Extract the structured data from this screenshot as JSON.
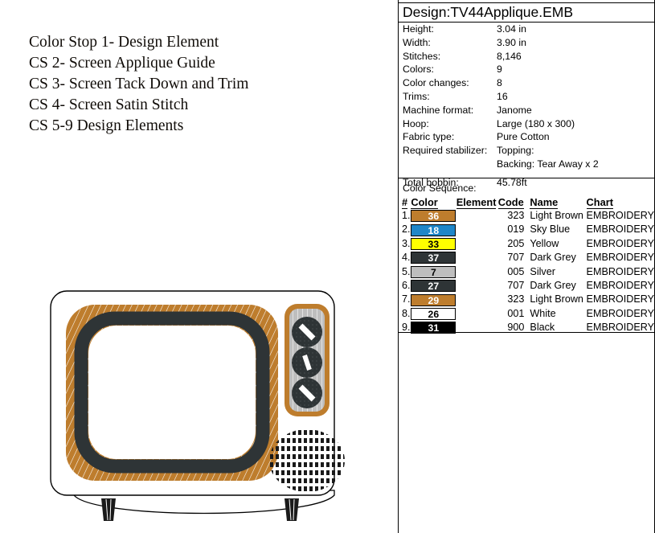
{
  "instructions": {
    "lines": [
      "Color Stop 1- Design Element",
      "CS 2- Screen Applique Guide",
      "CS 3- Screen Tack Down and Trim",
      "CS 4- Screen Satin Stitch",
      "CS 5-9 Design Elements"
    ]
  },
  "artwork": {
    "name": "vintage-television-embroidery-preview",
    "colors": {
      "cabinet_outline": "#000000",
      "bezel_brown": "#BE7D2D",
      "bezel_hatch": "#FFFFFF",
      "screen_border_dark": "#2E3436",
      "screen_fill": "#FFFFFF",
      "knob_panel_silver": "#BEBEBE",
      "knob_dark": "#2E3436",
      "knob_marker": "#FFFFFF",
      "speaker_dark": "#1A1A1A",
      "leg_dark": "#1A1A1A"
    },
    "knob_count": 3
  },
  "design": {
    "title": "Design:TV44Applique.EMB",
    "clipped_header": "",
    "info": [
      {
        "label": "Height:",
        "value": "3.04 in"
      },
      {
        "label": "Width:",
        "value": "3.90 in"
      },
      {
        "label": "Stitches:",
        "value": "8,146"
      },
      {
        "label": "Colors:",
        "value": "9"
      },
      {
        "label": "Color changes:",
        "value": "8"
      },
      {
        "label": "Trims:",
        "value": "16"
      },
      {
        "label": "Machine format:",
        "value": "Janome"
      },
      {
        "label": "Hoop:",
        "value": "Large (180 x 300)"
      },
      {
        "label": "Fabric type:",
        "value": "Pure Cotton"
      },
      {
        "label": "Required stabilizer:",
        "value": "Topping:"
      },
      {
        "label": "",
        "value": "Backing: Tear Away x 2"
      },
      {
        "label": "Total bobbin:",
        "value": "45.78ft"
      }
    ],
    "color_sequence_label": "Color Sequence:",
    "sequence_headers": [
      "#",
      "Color",
      "Element",
      "Code",
      "Name",
      "Chart"
    ],
    "sequence": [
      {
        "num": "1.",
        "swatch": "36",
        "swatch_color": "#BE7D2D",
        "swatch_text_color": "#FFFFFF",
        "element": "",
        "code": "323",
        "name": "Light Brown",
        "chart": "EMBROIDERY"
      },
      {
        "num": "2.",
        "swatch": "18",
        "swatch_color": "#1F86C8",
        "swatch_text_color": "#FFFFFF",
        "element": "",
        "code": "019",
        "name": "Sky Blue",
        "chart": "EMBROIDERY"
      },
      {
        "num": "3.",
        "swatch": "33",
        "swatch_color": "#FFFF00",
        "swatch_text_color": "#000000",
        "element": "",
        "code": "205",
        "name": "Yellow",
        "chart": "EMBROIDERY"
      },
      {
        "num": "4.",
        "swatch": "37",
        "swatch_color": "#2E3436",
        "swatch_text_color": "#FFFFFF",
        "element": "",
        "code": "707",
        "name": "Dark Grey",
        "chart": "EMBROIDERY"
      },
      {
        "num": "5.",
        "swatch": "7",
        "swatch_color": "#BEBEBE",
        "swatch_text_color": "#000000",
        "element": "",
        "code": "005",
        "name": "Silver",
        "chart": "EMBROIDERY"
      },
      {
        "num": "6.",
        "swatch": "27",
        "swatch_color": "#2E3436",
        "swatch_text_color": "#FFFFFF",
        "element": "",
        "code": "707",
        "name": "Dark Grey",
        "chart": "EMBROIDERY"
      },
      {
        "num": "7.",
        "swatch": "29",
        "swatch_color": "#BE7D2D",
        "swatch_text_color": "#FFFFFF",
        "element": "",
        "code": "323",
        "name": "Light Brown",
        "chart": "EMBROIDERY"
      },
      {
        "num": "8.",
        "swatch": "26",
        "swatch_color": "#FFFFFF",
        "swatch_text_color": "#000000",
        "element": "",
        "code": "001",
        "name": "White",
        "chart": "EMBROIDERY"
      },
      {
        "num": "9.",
        "swatch": "31",
        "swatch_color": "#000000",
        "swatch_text_color": "#FFFFFF",
        "element": "",
        "code": "900",
        "name": "Black",
        "chart": "EMBROIDERY"
      }
    ]
  }
}
